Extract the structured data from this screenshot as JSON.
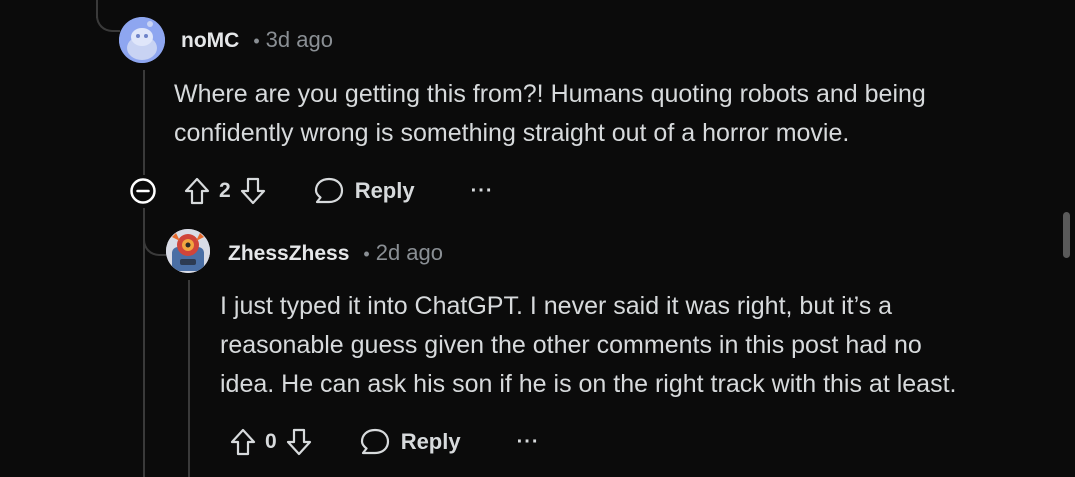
{
  "comments": [
    {
      "username": "noMC",
      "separator": "•",
      "time": "3d ago",
      "avatar": "reddit-snoo-default-avatar",
      "text_lines": [
        "Where are you getting this from?! Humans quoting robots and being",
        "confidently wrong is something straight out of a horror movie."
      ],
      "score": "2",
      "reply_label": "Reply",
      "more_label": "···"
    },
    {
      "username": "ZhessZhess",
      "separator": "•",
      "time": "2d ago",
      "avatar": "custom-robot-avatar",
      "text_lines": [
        "I just typed it into ChatGPT. I never said it was right, but it’s a",
        "reasonable guess given the other comments in this post had no",
        "idea. He can ask his son if he is on the right track with this at least."
      ],
      "score": "0",
      "reply_label": "Reply",
      "more_label": "···"
    }
  ],
  "colors": {
    "background": "#0b0b0b",
    "text": "#d7dadc",
    "muted": "#8a8f94",
    "thread_line": "#3a3a3a",
    "avatar_blue": "#8ea6f0"
  }
}
